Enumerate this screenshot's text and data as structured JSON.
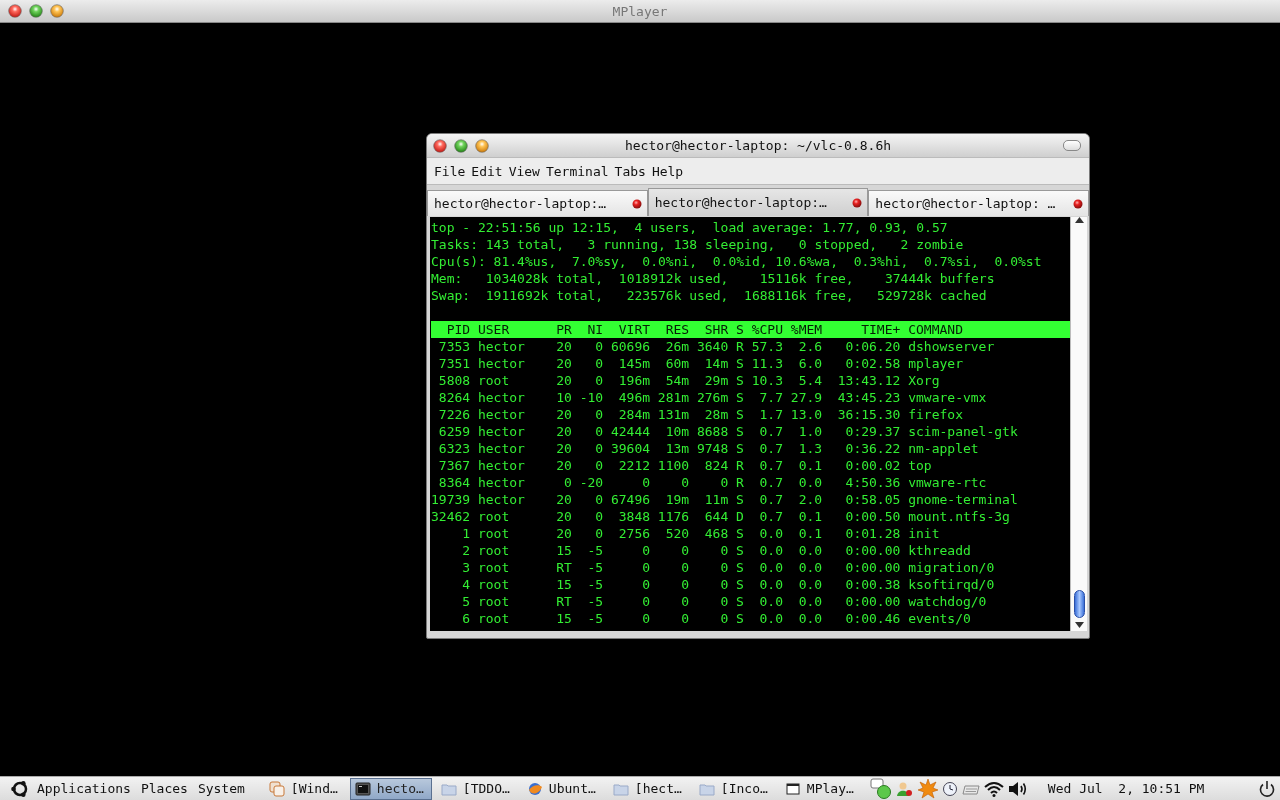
{
  "window": {
    "title": "MPlayer"
  },
  "terminal": {
    "title": "hector@hector-laptop: ~/vlc-0.8.6h",
    "menu": [
      "File",
      "Edit",
      "View",
      "Terminal",
      "Tabs",
      "Help"
    ],
    "tabs": [
      {
        "label": "hector@hector-laptop:…",
        "selected": false
      },
      {
        "label": "hector@hector-laptop:…",
        "selected": true
      },
      {
        "label": "hector@hector-laptop: …",
        "selected": false
      }
    ],
    "summary": [
      "top - 22:51:56 up 12:15,  4 users,  load average: 1.77, 0.93, 0.57",
      "Tasks: 143 total,   3 running, 138 sleeping,   0 stopped,   2 zombie",
      "Cpu(s): 81.4%us,  7.0%sy,  0.0%ni,  0.0%id, 10.6%wa,  0.3%hi,  0.7%si,  0.0%st",
      "Mem:   1034028k total,  1018912k used,    15116k free,    37444k buffers",
      "Swap:  1911692k total,   223576k used,  1688116k free,   529728k cached"
    ],
    "table": {
      "columns": [
        "PID",
        "USER",
        "PR",
        "NI",
        "VIRT",
        "RES",
        "SHR",
        "S",
        "%CPU",
        "%MEM",
        "TIME+",
        "COMMAND"
      ],
      "rows": [
        [
          "7353",
          "hector",
          "20",
          "0",
          "60696",
          "26m",
          "3640",
          "R",
          "57.3",
          "2.6",
          "0:06.20",
          "dshowserver"
        ],
        [
          "7351",
          "hector",
          "20",
          "0",
          "145m",
          "60m",
          "14m",
          "S",
          "11.3",
          "6.0",
          "0:02.58",
          "mplayer"
        ],
        [
          "5808",
          "root",
          "20",
          "0",
          "196m",
          "54m",
          "29m",
          "S",
          "10.3",
          "5.4",
          "13:43.12",
          "Xorg"
        ],
        [
          "8264",
          "hector",
          "10",
          "-10",
          "496m",
          "281m",
          "276m",
          "S",
          "7.7",
          "27.9",
          "43:45.23",
          "vmware-vmx"
        ],
        [
          "7226",
          "hector",
          "20",
          "0",
          "284m",
          "131m",
          "28m",
          "S",
          "1.7",
          "13.0",
          "36:15.30",
          "firefox"
        ],
        [
          "6259",
          "hector",
          "20",
          "0",
          "42444",
          "10m",
          "8688",
          "S",
          "0.7",
          "1.0",
          "0:29.37",
          "scim-panel-gtk"
        ],
        [
          "6323",
          "hector",
          "20",
          "0",
          "39604",
          "13m",
          "9748",
          "S",
          "0.7",
          "1.3",
          "0:36.22",
          "nm-applet"
        ],
        [
          "7367",
          "hector",
          "20",
          "0",
          "2212",
          "1100",
          "824",
          "R",
          "0.7",
          "0.1",
          "0:00.02",
          "top"
        ],
        [
          "8364",
          "hector",
          "0",
          "-20",
          "0",
          "0",
          "0",
          "R",
          "0.7",
          "0.0",
          "4:50.36",
          "vmware-rtc"
        ],
        [
          "19739",
          "hector",
          "20",
          "0",
          "67496",
          "19m",
          "11m",
          "S",
          "0.7",
          "2.0",
          "0:58.05",
          "gnome-terminal"
        ],
        [
          "32462",
          "root",
          "20",
          "0",
          "3848",
          "1176",
          "644",
          "D",
          "0.7",
          "0.1",
          "0:00.50",
          "mount.ntfs-3g"
        ],
        [
          "1",
          "root",
          "20",
          "0",
          "2756",
          "520",
          "468",
          "S",
          "0.0",
          "0.1",
          "0:01.28",
          "init"
        ],
        [
          "2",
          "root",
          "15",
          "-5",
          "0",
          "0",
          "0",
          "S",
          "0.0",
          "0.0",
          "0:00.00",
          "kthreadd"
        ],
        [
          "3",
          "root",
          "RT",
          "-5",
          "0",
          "0",
          "0",
          "S",
          "0.0",
          "0.0",
          "0:00.00",
          "migration/0"
        ],
        [
          "4",
          "root",
          "15",
          "-5",
          "0",
          "0",
          "0",
          "S",
          "0.0",
          "0.0",
          "0:00.38",
          "ksoftirqd/0"
        ],
        [
          "5",
          "root",
          "RT",
          "-5",
          "0",
          "0",
          "0",
          "S",
          "0.0",
          "0.0",
          "0:00.00",
          "watchdog/0"
        ],
        [
          "6",
          "root",
          "15",
          "-5",
          "0",
          "0",
          "0",
          "S",
          "0.0",
          "0.0",
          "0:00.46",
          "events/0"
        ]
      ]
    }
  },
  "taskbar": {
    "menus": [
      "Applications",
      "Places",
      "System"
    ],
    "tasks": [
      {
        "label": "[Wind…",
        "selected": false
      },
      {
        "label": "hecto…",
        "selected": true
      },
      {
        "label": "[TDDO…",
        "selected": false
      },
      {
        "label": "Ubunt…",
        "selected": false
      },
      {
        "label": "[hect…",
        "selected": false
      },
      {
        "label": "[Inco…",
        "selected": false
      },
      {
        "label": "MPlay…",
        "selected": false
      }
    ],
    "clock": "Wed Jul  2, 10:51 PM"
  }
}
